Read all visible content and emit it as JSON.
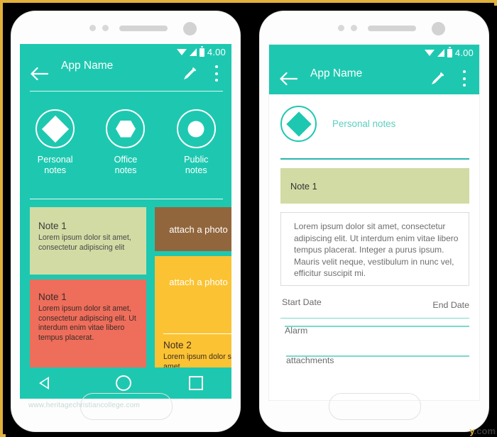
{
  "statusbar": {
    "time": "4.00",
    "icons": [
      "wifi-icon",
      "signal-icon",
      "battery-icon"
    ]
  },
  "appbar": {
    "title": "App Name",
    "back_icon": "back-arrow-icon",
    "edit_icon": "pencil-icon",
    "overflow_icon": "kebab-menu-icon"
  },
  "left_screen": {
    "categories": [
      {
        "label": "Personal\nnotes",
        "label_line1": "Personal",
        "label_line2": "notes",
        "shape": "diamond-icon"
      },
      {
        "label": "Office notes",
        "label_line1": "Office",
        "label_line2": "notes",
        "shape": "hexagon-icon"
      },
      {
        "label": "Public notes",
        "label_line1": "Public",
        "label_line2": "notes",
        "shape": "circle-icon"
      }
    ],
    "cards": {
      "note_green": {
        "title": "Note 1",
        "body": "Lorem ipsum dolor sit amet, consectetur adipiscing elit",
        "color": "#d2dba4"
      },
      "note_red": {
        "title": "Note 1",
        "body": "Lorem ipsum dolor sit amet, consectetur adipiscing elit. Ut interdum enim vitae libero tempus placerat.",
        "color": "#ee6e5b"
      },
      "attach_brown": {
        "label": "attach a photo",
        "color": "#92663c"
      },
      "attach_yellow": {
        "label": "attach a photo",
        "color": "#fbc333",
        "title": "Note 2",
        "body": "Lorem ipsum dolor sit amet,"
      }
    },
    "navbar": {
      "back": "nav-back-icon",
      "home": "nav-home-icon",
      "recents": "nav-recents-icon"
    }
  },
  "right_screen": {
    "category": {
      "label": "Personal notes",
      "shape": "diamond-icon"
    },
    "title_field": {
      "value": "Note 1"
    },
    "description_field": {
      "value": "Lorem ipsum dolor sit amet, consectetur adipiscing elit. Ut interdum enim vitae libero tempus placerat. Integer a purus ipsum. Mauris velit neque, vestibulum in nunc vel, efficitur suscipit mi."
    },
    "start_date_label": "Start Date",
    "end_date_label": "End Date",
    "alarm_label": "Alarm",
    "attachments_label": "attachments"
  },
  "watermarks": {
    "left": "www.heritagechristiancollege.com",
    "right": "y.com"
  },
  "theme": {
    "accent": "#1ec8b0",
    "frame": "#e2b13c",
    "backdrop": "#000000"
  }
}
